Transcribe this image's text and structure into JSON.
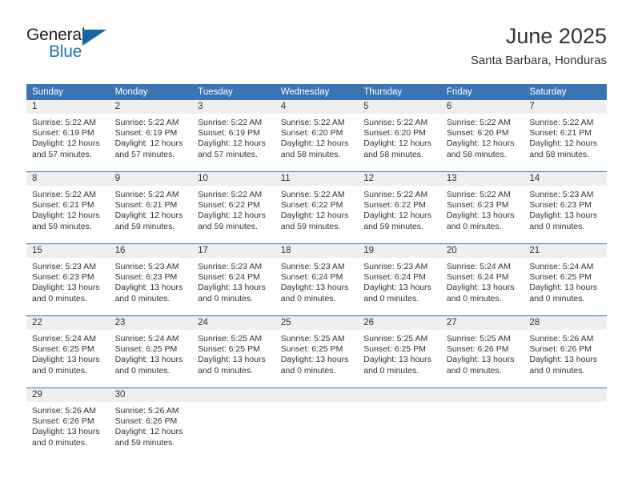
{
  "brand": {
    "name_part1": "General",
    "name_part2": "Blue",
    "triangle_color": "#15659f",
    "blue_color": "#1e72b8"
  },
  "header": {
    "month_title": "June 2025",
    "location": "Santa Barbara, Honduras"
  },
  "theme": {
    "header_bg": "#3b74b4",
    "row_divider": "#2e6da9",
    "day_band_bg": "#efefef",
    "text": "#333333"
  },
  "weekday_headers": [
    "Sunday",
    "Monday",
    "Tuesday",
    "Wednesday",
    "Thursday",
    "Friday",
    "Saturday"
  ],
  "weeks": [
    [
      {
        "day": "1",
        "sunrise": "Sunrise: 5:22 AM",
        "sunset": "Sunset: 6:19 PM",
        "daylight_line1": "Daylight: 12 hours",
        "daylight_line2": "and 57 minutes."
      },
      {
        "day": "2",
        "sunrise": "Sunrise: 5:22 AM",
        "sunset": "Sunset: 6:19 PM",
        "daylight_line1": "Daylight: 12 hours",
        "daylight_line2": "and 57 minutes."
      },
      {
        "day": "3",
        "sunrise": "Sunrise: 5:22 AM",
        "sunset": "Sunset: 6:19 PM",
        "daylight_line1": "Daylight: 12 hours",
        "daylight_line2": "and 57 minutes."
      },
      {
        "day": "4",
        "sunrise": "Sunrise: 5:22 AM",
        "sunset": "Sunset: 6:20 PM",
        "daylight_line1": "Daylight: 12 hours",
        "daylight_line2": "and 58 minutes."
      },
      {
        "day": "5",
        "sunrise": "Sunrise: 5:22 AM",
        "sunset": "Sunset: 6:20 PM",
        "daylight_line1": "Daylight: 12 hours",
        "daylight_line2": "and 58 minutes."
      },
      {
        "day": "6",
        "sunrise": "Sunrise: 5:22 AM",
        "sunset": "Sunset: 6:20 PM",
        "daylight_line1": "Daylight: 12 hours",
        "daylight_line2": "and 58 minutes."
      },
      {
        "day": "7",
        "sunrise": "Sunrise: 5:22 AM",
        "sunset": "Sunset: 6:21 PM",
        "daylight_line1": "Daylight: 12 hours",
        "daylight_line2": "and 58 minutes."
      }
    ],
    [
      {
        "day": "8",
        "sunrise": "Sunrise: 5:22 AM",
        "sunset": "Sunset: 6:21 PM",
        "daylight_line1": "Daylight: 12 hours",
        "daylight_line2": "and 59 minutes."
      },
      {
        "day": "9",
        "sunrise": "Sunrise: 5:22 AM",
        "sunset": "Sunset: 6:21 PM",
        "daylight_line1": "Daylight: 12 hours",
        "daylight_line2": "and 59 minutes."
      },
      {
        "day": "10",
        "sunrise": "Sunrise: 5:22 AM",
        "sunset": "Sunset: 6:22 PM",
        "daylight_line1": "Daylight: 12 hours",
        "daylight_line2": "and 59 minutes."
      },
      {
        "day": "11",
        "sunrise": "Sunrise: 5:22 AM",
        "sunset": "Sunset: 6:22 PM",
        "daylight_line1": "Daylight: 12 hours",
        "daylight_line2": "and 59 minutes."
      },
      {
        "day": "12",
        "sunrise": "Sunrise: 5:22 AM",
        "sunset": "Sunset: 6:22 PM",
        "daylight_line1": "Daylight: 12 hours",
        "daylight_line2": "and 59 minutes."
      },
      {
        "day": "13",
        "sunrise": "Sunrise: 5:22 AM",
        "sunset": "Sunset: 6:23 PM",
        "daylight_line1": "Daylight: 13 hours",
        "daylight_line2": "and 0 minutes."
      },
      {
        "day": "14",
        "sunrise": "Sunrise: 5:23 AM",
        "sunset": "Sunset: 6:23 PM",
        "daylight_line1": "Daylight: 13 hours",
        "daylight_line2": "and 0 minutes."
      }
    ],
    [
      {
        "day": "15",
        "sunrise": "Sunrise: 5:23 AM",
        "sunset": "Sunset: 6:23 PM",
        "daylight_line1": "Daylight: 13 hours",
        "daylight_line2": "and 0 minutes."
      },
      {
        "day": "16",
        "sunrise": "Sunrise: 5:23 AM",
        "sunset": "Sunset: 6:23 PM",
        "daylight_line1": "Daylight: 13 hours",
        "daylight_line2": "and 0 minutes."
      },
      {
        "day": "17",
        "sunrise": "Sunrise: 5:23 AM",
        "sunset": "Sunset: 6:24 PM",
        "daylight_line1": "Daylight: 13 hours",
        "daylight_line2": "and 0 minutes."
      },
      {
        "day": "18",
        "sunrise": "Sunrise: 5:23 AM",
        "sunset": "Sunset: 6:24 PM",
        "daylight_line1": "Daylight: 13 hours",
        "daylight_line2": "and 0 minutes."
      },
      {
        "day": "19",
        "sunrise": "Sunrise: 5:23 AM",
        "sunset": "Sunset: 6:24 PM",
        "daylight_line1": "Daylight: 13 hours",
        "daylight_line2": "and 0 minutes."
      },
      {
        "day": "20",
        "sunrise": "Sunrise: 5:24 AM",
        "sunset": "Sunset: 6:24 PM",
        "daylight_line1": "Daylight: 13 hours",
        "daylight_line2": "and 0 minutes."
      },
      {
        "day": "21",
        "sunrise": "Sunrise: 5:24 AM",
        "sunset": "Sunset: 6:25 PM",
        "daylight_line1": "Daylight: 13 hours",
        "daylight_line2": "and 0 minutes."
      }
    ],
    [
      {
        "day": "22",
        "sunrise": "Sunrise: 5:24 AM",
        "sunset": "Sunset: 6:25 PM",
        "daylight_line1": "Daylight: 13 hours",
        "daylight_line2": "and 0 minutes."
      },
      {
        "day": "23",
        "sunrise": "Sunrise: 5:24 AM",
        "sunset": "Sunset: 6:25 PM",
        "daylight_line1": "Daylight: 13 hours",
        "daylight_line2": "and 0 minutes."
      },
      {
        "day": "24",
        "sunrise": "Sunrise: 5:25 AM",
        "sunset": "Sunset: 6:25 PM",
        "daylight_line1": "Daylight: 13 hours",
        "daylight_line2": "and 0 minutes."
      },
      {
        "day": "25",
        "sunrise": "Sunrise: 5:25 AM",
        "sunset": "Sunset: 6:25 PM",
        "daylight_line1": "Daylight: 13 hours",
        "daylight_line2": "and 0 minutes."
      },
      {
        "day": "26",
        "sunrise": "Sunrise: 5:25 AM",
        "sunset": "Sunset: 6:25 PM",
        "daylight_line1": "Daylight: 13 hours",
        "daylight_line2": "and 0 minutes."
      },
      {
        "day": "27",
        "sunrise": "Sunrise: 5:25 AM",
        "sunset": "Sunset: 6:26 PM",
        "daylight_line1": "Daylight: 13 hours",
        "daylight_line2": "and 0 minutes."
      },
      {
        "day": "28",
        "sunrise": "Sunrise: 5:26 AM",
        "sunset": "Sunset: 6:26 PM",
        "daylight_line1": "Daylight: 13 hours",
        "daylight_line2": "and 0 minutes."
      }
    ],
    [
      {
        "day": "29",
        "sunrise": "Sunrise: 5:26 AM",
        "sunset": "Sunset: 6:26 PM",
        "daylight_line1": "Daylight: 13 hours",
        "daylight_line2": "and 0 minutes."
      },
      {
        "day": "30",
        "sunrise": "Sunrise: 5:26 AM",
        "sunset": "Sunset: 6:26 PM",
        "daylight_line1": "Daylight: 12 hours",
        "daylight_line2": "and 59 minutes."
      },
      {
        "day": "",
        "sunrise": "",
        "sunset": "",
        "daylight_line1": "",
        "daylight_line2": ""
      },
      {
        "day": "",
        "sunrise": "",
        "sunset": "",
        "daylight_line1": "",
        "daylight_line2": ""
      },
      {
        "day": "",
        "sunrise": "",
        "sunset": "",
        "daylight_line1": "",
        "daylight_line2": ""
      },
      {
        "day": "",
        "sunrise": "",
        "sunset": "",
        "daylight_line1": "",
        "daylight_line2": ""
      },
      {
        "day": "",
        "sunrise": "",
        "sunset": "",
        "daylight_line1": "",
        "daylight_line2": ""
      }
    ]
  ]
}
